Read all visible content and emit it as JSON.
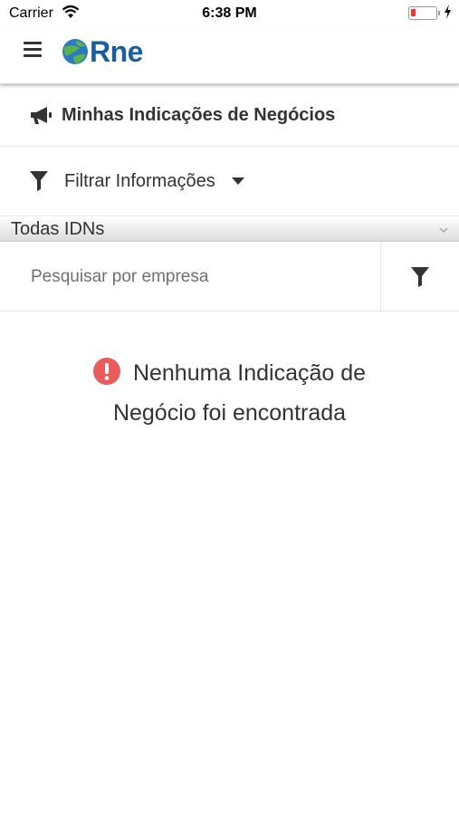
{
  "status_bar": {
    "carrier": "Carrier",
    "time": "6:38 PM",
    "battery_level_percent": 10,
    "battery_color": "#e33333",
    "icons": [
      "wifi-icon",
      "battery-icon",
      "charging-bolt-icon"
    ]
  },
  "header": {
    "menu_icon": "hamburger-menu-icon",
    "logo_text": "Rne",
    "logo_globe_colors": [
      "#2b7bc2",
      "#5cb34a"
    ]
  },
  "page": {
    "title_icon": "megaphone-icon",
    "title": "Minhas Indicações de Negócios"
  },
  "filter": {
    "icon": "filter-icon",
    "label": "Filtrar Informações",
    "caret_icon": "caret-down-icon"
  },
  "select": {
    "value": "Todas IDNs",
    "chevron_icon": "chevron-down-icon"
  },
  "search": {
    "placeholder": "Pesquisar por empresa",
    "value": "",
    "filter_button_icon": "filter-icon"
  },
  "empty_state": {
    "icon": "alert-circle-icon",
    "icon_color": "#ea5b5b",
    "line1": "Nenhuma Indicação de",
    "line2": "Negócio foi encontrada"
  }
}
